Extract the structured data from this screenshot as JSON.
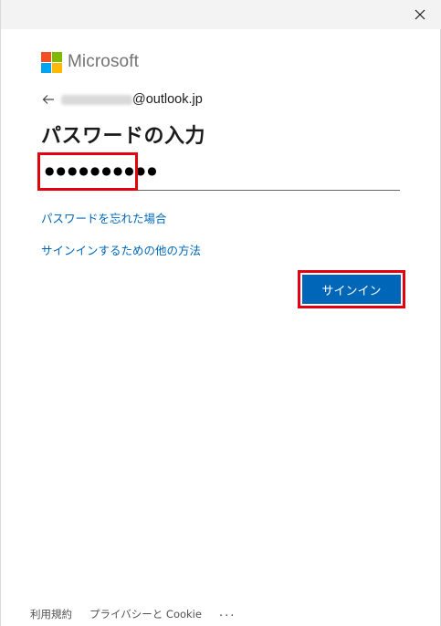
{
  "window": {
    "close_icon": "close-icon"
  },
  "brand": {
    "name": "Microsoft",
    "logo_colors": [
      "#f25022",
      "#7fba00",
      "#00a4ef",
      "#ffb900"
    ]
  },
  "identity": {
    "back_icon": "arrow-left-icon",
    "email_domain": "@outlook.jp"
  },
  "form": {
    "title": "パスワードの入力",
    "password_mask": "●●●●●●●●●●",
    "forgot_link": "パスワードを忘れた場合",
    "other_signin_link": "サインインするための他の方法",
    "submit_label": "サインイン"
  },
  "footer": {
    "terms": "利用規約",
    "privacy": "プライバシーと Cookie",
    "more": "..."
  },
  "colors": {
    "accent": "#0067b8",
    "highlight": "#e3000f"
  }
}
